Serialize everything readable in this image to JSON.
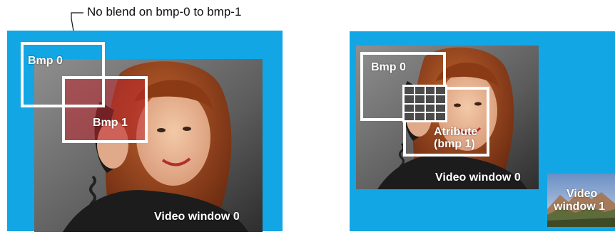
{
  "caption": "No blend on bmp-0 to bmp-1",
  "left_panel": {
    "bmp0_label": "Bmp 0",
    "bmp1_label": "Bmp 1",
    "video_label": "Video window 0"
  },
  "right_panel": {
    "bmp0_label": "Bmp 0",
    "attribute_label_line1": "Atribute",
    "attribute_label_line2": "(bmp 1)",
    "video0_label": "Video window 0",
    "video1_label_line1": "Video",
    "video1_label_line2": "window 1"
  },
  "colors": {
    "background_blue": "#12a6e4",
    "frame_white": "#ffffff",
    "bmp1_overlay": "#c0282f"
  }
}
